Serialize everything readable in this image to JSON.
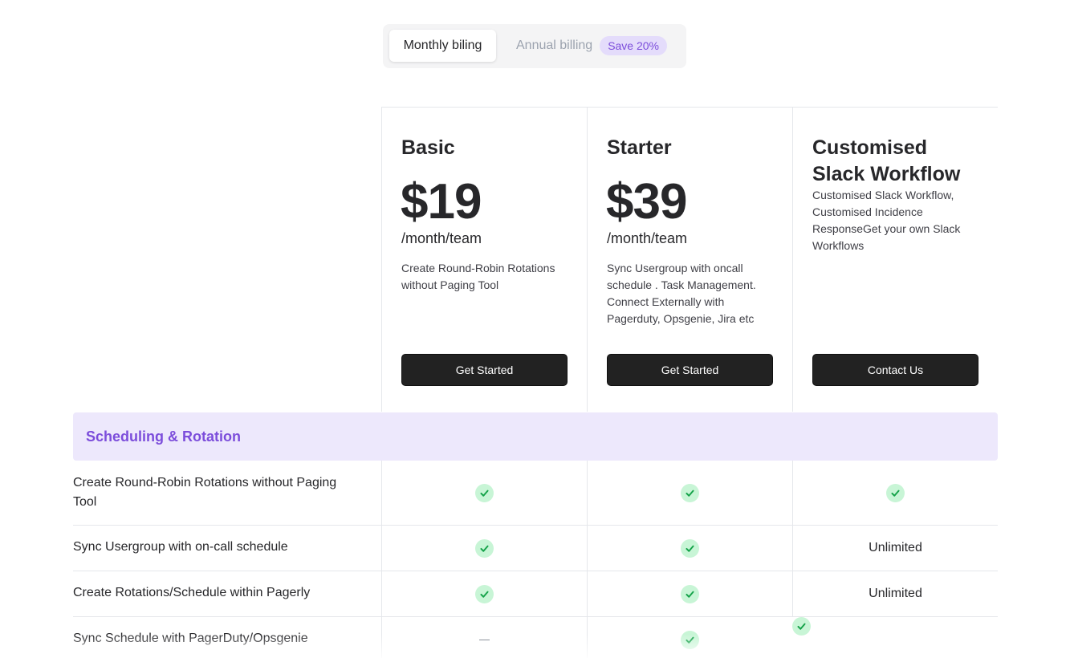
{
  "billing_toggle": {
    "monthly_label": "Monthly biling",
    "annual_label": "Annual billing",
    "save_badge": "Save 20%"
  },
  "plans": [
    {
      "name": "Basic",
      "price": "$19",
      "unit": "/month/team",
      "description": "Create Round-Robin Rotations without Paging Tool",
      "cta": "Get Started"
    },
    {
      "name": "Starter",
      "price": "$39",
      "unit": "/month/team",
      "description": "Sync Usergroup with oncall schedule . Task Management. Connect Externally with Pagerduty, Opsgenie, Jira etc",
      "cta": "Get Started"
    },
    {
      "name": "Customised Slack Workflow",
      "description": "Customised Slack Workflow, Customised Incidence ResponseGet your own Slack Workflows",
      "cta": "Contact Us"
    }
  ],
  "section": {
    "title": "Scheduling & Rotation"
  },
  "features": [
    {
      "label": "Create Round-Robin Rotations without Paging Tool",
      "values": [
        "check",
        "check",
        "check"
      ]
    },
    {
      "label": "Sync Usergroup with on-call schedule",
      "values": [
        "check",
        "check",
        "Unlimited"
      ]
    },
    {
      "label": "Create Rotations/Schedule within Pagerly",
      "values": [
        "check",
        "check",
        "Unlimited"
      ]
    },
    {
      "label": "Sync Schedule with PagerDuty/Opsgenie",
      "values": [
        "dash",
        "check",
        ""
      ]
    }
  ],
  "colors": {
    "accent": "#7c4ddb",
    "section_bg": "#ede8fc",
    "check_bg": "#c8f5d6",
    "check_mark": "#16a34a",
    "button_bg": "#222222"
  }
}
